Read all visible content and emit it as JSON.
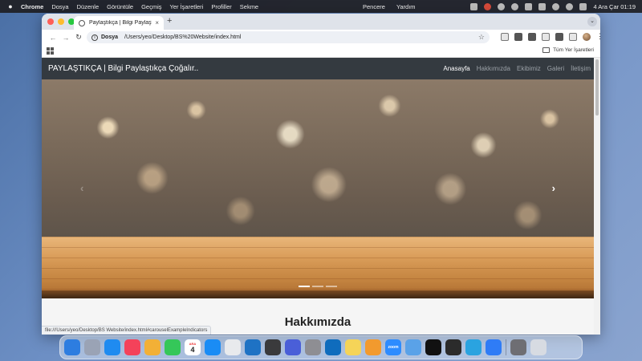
{
  "menubar": {
    "app": "Chrome",
    "items": [
      "Dosya",
      "Düzenle",
      "Görüntüle",
      "Geçmiş",
      "Yer İşaretleri",
      "Profiller",
      "Sekme"
    ],
    "right_items": [
      "Pencere",
      "Yardım"
    ],
    "datetime": "4 Ara Çar  01:19"
  },
  "browser": {
    "tab_title": "Paylaştıkça | Bilgi Paylaştıkça Ç...",
    "new_tab": "+",
    "address_scheme": "Dosya",
    "address_url": "/Users/yeo/Desktop/BS%20Website/index.html",
    "bookmarks_all": "Tüm Yer İşaretleri",
    "status_url": "file:///Users/yeo/Desktop/BS Website/index.html#carouselExampleIndicators"
  },
  "site": {
    "brand": "PAYLAŞTIKÇA | Bilgi Paylaştıkça Çoğalır..",
    "nav": [
      "Anasayfa",
      "Hakkımızda",
      "Ekibimiz",
      "Galeri",
      "İletişim"
    ],
    "active_nav": "Anasayfa",
    "carousel_prev": "‹",
    "carousel_next": "›",
    "slides_total": 3,
    "slide_active": 1,
    "section_title": "Hakkımızda"
  },
  "dock": {
    "calendar_month": "ARA",
    "calendar_day": "4",
    "zoom_label": "zoom",
    "apps": [
      {
        "name": "finder",
        "color": "#2d7de0"
      },
      {
        "name": "launchpad",
        "color": "#9aa3b5"
      },
      {
        "name": "safari",
        "color": "#1f8bf0"
      },
      {
        "name": "music",
        "color": "#f4425a"
      },
      {
        "name": "photos",
        "color": "#f2b036"
      },
      {
        "name": "facetime",
        "color": "#35c759"
      },
      {
        "name": "calendar",
        "color": "#ffffff"
      },
      {
        "name": "app-store",
        "color": "#1a8cf5"
      },
      {
        "name": "chrome",
        "color": "#e8eaed"
      },
      {
        "name": "vscode",
        "color": "#1e72c4"
      },
      {
        "name": "quicktime",
        "color": "#3a3a3c"
      },
      {
        "name": "imovie",
        "color": "#4a5fd8"
      },
      {
        "name": "system-settings",
        "color": "#8e8e93"
      },
      {
        "name": "outlook",
        "color": "#0f6cbd"
      },
      {
        "name": "notes",
        "color": "#f5d458"
      },
      {
        "name": "pages",
        "color": "#f29a2e"
      },
      {
        "name": "zoom",
        "color": "#2d8cff"
      },
      {
        "name": "preview",
        "color": "#5aa2e8"
      },
      {
        "name": "github",
        "color": "#111111"
      },
      {
        "name": "terminal",
        "color": "#2b2b2b"
      },
      {
        "name": "telegram",
        "color": "#2aa3e0"
      },
      {
        "name": "screen-recorder",
        "color": "#2f7cf6"
      },
      {
        "name": "calculator",
        "color": "#6e6e73"
      },
      {
        "name": "trash",
        "color": "#d7dbe2"
      }
    ]
  }
}
